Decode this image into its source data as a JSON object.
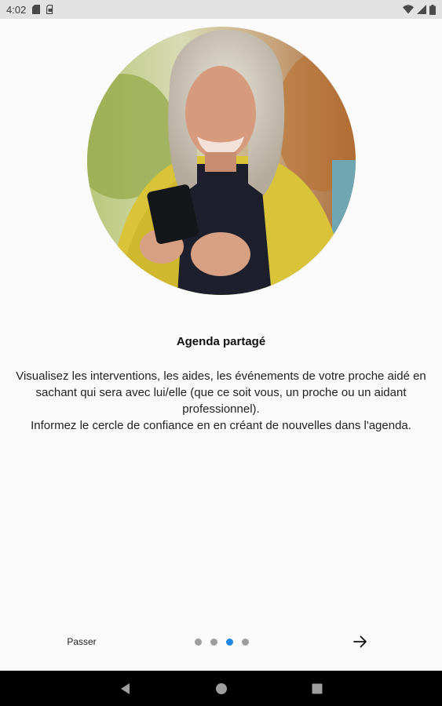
{
  "status_bar": {
    "time": "4:02",
    "icons": [
      "sd-card-icon",
      "sim-icon",
      "wifi-icon",
      "cell-signal-icon",
      "battery-icon"
    ]
  },
  "onboarding": {
    "image_subject": "woman-using-smartphone-photo",
    "title": "Agenda partagé",
    "description_line1": "Visualisez les interventions, les aides, les événements de votre proche aidé en sachant qui sera avec lui/elle (que ce soit vous, un proche ou un aidant professionnel).",
    "description_line2": "Informez le cercle de confiance en en créant de nouvelles dans l'agenda."
  },
  "footer": {
    "skip_label": "Passer",
    "page_indicator": {
      "count": 4,
      "active_index": 2
    },
    "next_icon": "arrow-right-icon"
  },
  "system_nav": {
    "buttons": [
      "back-icon",
      "home-icon",
      "recents-icon"
    ]
  },
  "colors": {
    "accent": "#1e88e5",
    "dot_inactive": "#9e9e9e",
    "background": "#fafafa",
    "status_bar": "#e2e2e2",
    "nav_bar": "#000000"
  }
}
